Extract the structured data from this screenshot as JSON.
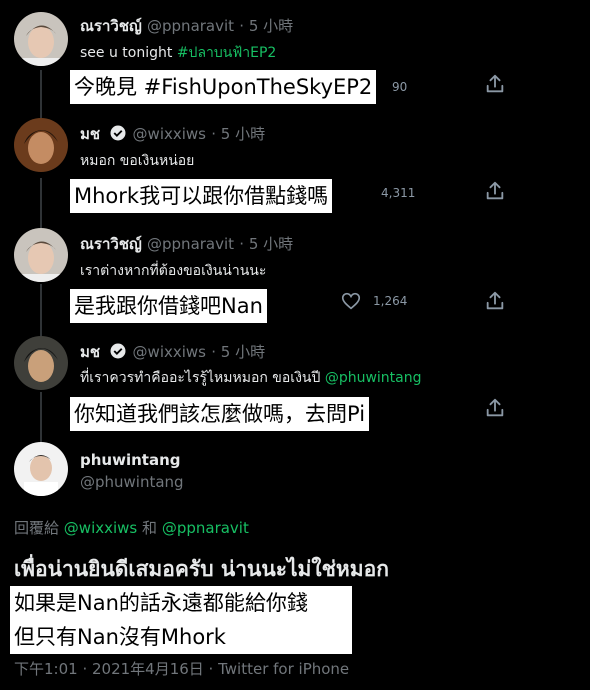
{
  "tweets": [
    {
      "display_name": "ณราวิชญ์",
      "handle": "@ppnaravit",
      "time": "· 5 小時",
      "text": "see u tonight",
      "hashtag": "#ปลาบนฟ้าEP2",
      "translation": "今晚見 #FishUponTheSkyEP2",
      "like_count": "90"
    },
    {
      "display_name": "มช",
      "handle": "@wixxiws",
      "time": "· 5 小時",
      "verified": true,
      "text": "หมอก ขอเงินหน่อย",
      "translation": "Mhork我可以跟你借點錢嗎",
      "like_count": "4,311"
    },
    {
      "display_name": "ณราวิชญ์",
      "handle": "@ppnaravit",
      "time": "· 5 小時",
      "text": "เราต่างหากที่ต้องขอเงินน่านนะ",
      "translation": "是我跟你借錢吧Nan",
      "like_count": "1,264"
    },
    {
      "display_name": "มช",
      "handle": "@wixxiws",
      "time": "· 5 小時",
      "verified": true,
      "text": "ที่เราควรทำคืออะไรรู้ไหมหมอก ขอเงินปี",
      "mention": "@phuwintang",
      "translation": "你知道我們該怎麼做嗎，去問Pi"
    }
  ],
  "main_tweet": {
    "display_name": "phuwintang",
    "handle": "@phuwintang",
    "reply_prefix": "回覆給",
    "reply_to_1": "@wixxiws",
    "reply_and": "和",
    "reply_to_2": "@ppnaravit",
    "text": "เพื่อน่านยินดีเสมอครับ น่านนะไม่ใช่หมอก",
    "translation_1": "如果是Nan的話永遠都能給你錢",
    "translation_2": "但只有Nan沒有Mhork",
    "meta": "下午1:01 · 2021年4月16日 · Twitter for iPhone"
  },
  "icons": [
    "heart-icon",
    "share-icon",
    "verified-badge-icon"
  ],
  "colors": {
    "background": "#000000",
    "accent": "#1d9bf0",
    "hashtag": "#17bf63",
    "muted": "#71767b"
  }
}
